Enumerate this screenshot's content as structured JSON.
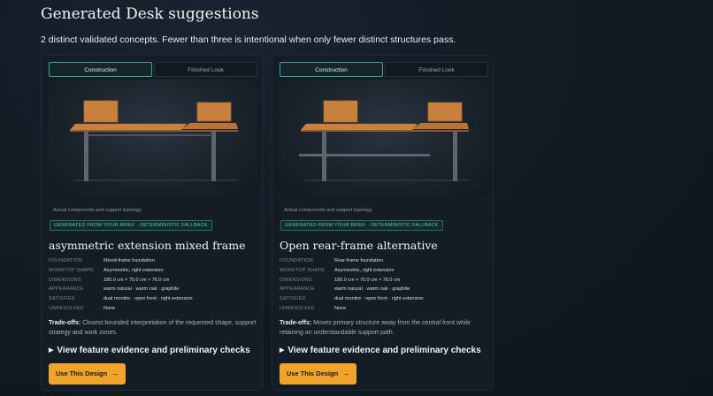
{
  "page": {
    "title": "Generated Desk suggestions",
    "subtitle": "2 distinct validated concepts. Fewer than three is intentional when only fewer distinct structures pass."
  },
  "colors": {
    "accent": "#f0a52a",
    "teal": "#3aa69c",
    "wood": "#c9813f",
    "frame": "#5b6670"
  },
  "icons": {
    "disclosure": "triangle-right-icon",
    "button_arrow": "arrow-right-icon"
  },
  "cards": [
    {
      "tabs": [
        "Construction",
        "Finished Look"
      ],
      "active_tab": "Construction",
      "render_caption": "Actual components and support topology",
      "badge": "GENERATED FROM YOUR BRIEF · DETERMINISTIC FALLBACK",
      "title": "asymmetric extension mixed frame",
      "specs": [
        {
          "key": "FOUNDATION",
          "value": "Mixed-frame foundation"
        },
        {
          "key": "WORKTOP SHAPE",
          "value": "Asymmetric, right extension"
        },
        {
          "key": "DIMENSIONS",
          "value": "180.0 cm × 75.0 cm × 76.0 cm"
        },
        {
          "key": "APPEARANCE",
          "value": "warm natural · warm oak · graphite"
        },
        {
          "key": "SATISFIED",
          "value": "dual monitor · open front · right extension"
        },
        {
          "key": "UNRESOLVED",
          "value": "None"
        }
      ],
      "tradeoffs_label": "Trade-offs:",
      "tradeoffs_text": "Closest bounded interpretation of the requested shape, support strategy and work zones.",
      "evidence_label": "View feature evidence and preliminary checks",
      "button_label": "Use This Design"
    },
    {
      "tabs": [
        "Construction",
        "Finished Look"
      ],
      "active_tab": "Construction",
      "render_caption": "Actual components and support topology",
      "badge": "GENERATED FROM YOUR BRIEF · DETERMINISTIC FALLBACK",
      "title": "Open rear-frame alternative",
      "specs": [
        {
          "key": "FOUNDATION",
          "value": "Rear-frame foundation"
        },
        {
          "key": "WORKTOP SHAPE",
          "value": "Asymmetric, right extension"
        },
        {
          "key": "DIMENSIONS",
          "value": "180.0 cm × 75.0 cm × 76.0 cm"
        },
        {
          "key": "APPEARANCE",
          "value": "warm natural · warm oak · graphite"
        },
        {
          "key": "SATISFIED",
          "value": "dual monitor · open front · right extension"
        },
        {
          "key": "UNRESOLVED",
          "value": "None"
        }
      ],
      "tradeoffs_label": "Trade-offs:",
      "tradeoffs_text": "Moves primary structure away from the central front while retaining an understandable support path.",
      "evidence_label": "View feature evidence and preliminary checks",
      "button_label": "Use This Design"
    }
  ]
}
